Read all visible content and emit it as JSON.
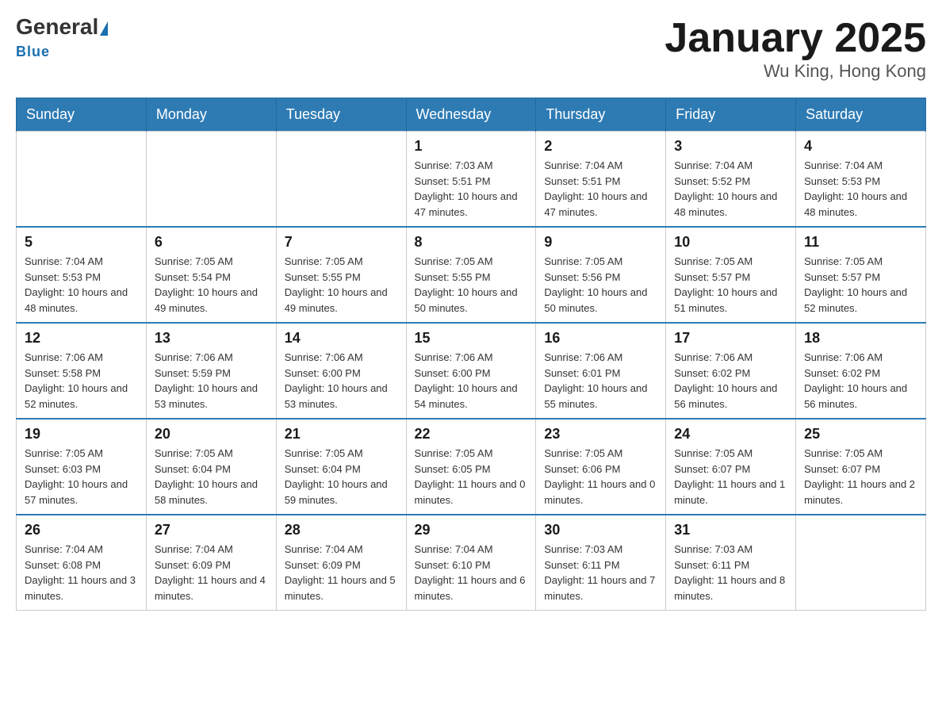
{
  "header": {
    "logo_general": "General",
    "logo_blue": "Blue",
    "title": "January 2025",
    "subtitle": "Wu King, Hong Kong"
  },
  "days_of_week": [
    "Sunday",
    "Monday",
    "Tuesday",
    "Wednesday",
    "Thursday",
    "Friday",
    "Saturday"
  ],
  "weeks": [
    [
      {
        "day": "",
        "info": ""
      },
      {
        "day": "",
        "info": ""
      },
      {
        "day": "",
        "info": ""
      },
      {
        "day": "1",
        "info": "Sunrise: 7:03 AM\nSunset: 5:51 PM\nDaylight: 10 hours\nand 47 minutes."
      },
      {
        "day": "2",
        "info": "Sunrise: 7:04 AM\nSunset: 5:51 PM\nDaylight: 10 hours\nand 47 minutes."
      },
      {
        "day": "3",
        "info": "Sunrise: 7:04 AM\nSunset: 5:52 PM\nDaylight: 10 hours\nand 48 minutes."
      },
      {
        "day": "4",
        "info": "Sunrise: 7:04 AM\nSunset: 5:53 PM\nDaylight: 10 hours\nand 48 minutes."
      }
    ],
    [
      {
        "day": "5",
        "info": "Sunrise: 7:04 AM\nSunset: 5:53 PM\nDaylight: 10 hours\nand 48 minutes."
      },
      {
        "day": "6",
        "info": "Sunrise: 7:05 AM\nSunset: 5:54 PM\nDaylight: 10 hours\nand 49 minutes."
      },
      {
        "day": "7",
        "info": "Sunrise: 7:05 AM\nSunset: 5:55 PM\nDaylight: 10 hours\nand 49 minutes."
      },
      {
        "day": "8",
        "info": "Sunrise: 7:05 AM\nSunset: 5:55 PM\nDaylight: 10 hours\nand 50 minutes."
      },
      {
        "day": "9",
        "info": "Sunrise: 7:05 AM\nSunset: 5:56 PM\nDaylight: 10 hours\nand 50 minutes."
      },
      {
        "day": "10",
        "info": "Sunrise: 7:05 AM\nSunset: 5:57 PM\nDaylight: 10 hours\nand 51 minutes."
      },
      {
        "day": "11",
        "info": "Sunrise: 7:05 AM\nSunset: 5:57 PM\nDaylight: 10 hours\nand 52 minutes."
      }
    ],
    [
      {
        "day": "12",
        "info": "Sunrise: 7:06 AM\nSunset: 5:58 PM\nDaylight: 10 hours\nand 52 minutes."
      },
      {
        "day": "13",
        "info": "Sunrise: 7:06 AM\nSunset: 5:59 PM\nDaylight: 10 hours\nand 53 minutes."
      },
      {
        "day": "14",
        "info": "Sunrise: 7:06 AM\nSunset: 6:00 PM\nDaylight: 10 hours\nand 53 minutes."
      },
      {
        "day": "15",
        "info": "Sunrise: 7:06 AM\nSunset: 6:00 PM\nDaylight: 10 hours\nand 54 minutes."
      },
      {
        "day": "16",
        "info": "Sunrise: 7:06 AM\nSunset: 6:01 PM\nDaylight: 10 hours\nand 55 minutes."
      },
      {
        "day": "17",
        "info": "Sunrise: 7:06 AM\nSunset: 6:02 PM\nDaylight: 10 hours\nand 56 minutes."
      },
      {
        "day": "18",
        "info": "Sunrise: 7:06 AM\nSunset: 6:02 PM\nDaylight: 10 hours\nand 56 minutes."
      }
    ],
    [
      {
        "day": "19",
        "info": "Sunrise: 7:05 AM\nSunset: 6:03 PM\nDaylight: 10 hours\nand 57 minutes."
      },
      {
        "day": "20",
        "info": "Sunrise: 7:05 AM\nSunset: 6:04 PM\nDaylight: 10 hours\nand 58 minutes."
      },
      {
        "day": "21",
        "info": "Sunrise: 7:05 AM\nSunset: 6:04 PM\nDaylight: 10 hours\nand 59 minutes."
      },
      {
        "day": "22",
        "info": "Sunrise: 7:05 AM\nSunset: 6:05 PM\nDaylight: 11 hours\nand 0 minutes."
      },
      {
        "day": "23",
        "info": "Sunrise: 7:05 AM\nSunset: 6:06 PM\nDaylight: 11 hours\nand 0 minutes."
      },
      {
        "day": "24",
        "info": "Sunrise: 7:05 AM\nSunset: 6:07 PM\nDaylight: 11 hours\nand 1 minute."
      },
      {
        "day": "25",
        "info": "Sunrise: 7:05 AM\nSunset: 6:07 PM\nDaylight: 11 hours\nand 2 minutes."
      }
    ],
    [
      {
        "day": "26",
        "info": "Sunrise: 7:04 AM\nSunset: 6:08 PM\nDaylight: 11 hours\nand 3 minutes."
      },
      {
        "day": "27",
        "info": "Sunrise: 7:04 AM\nSunset: 6:09 PM\nDaylight: 11 hours\nand 4 minutes."
      },
      {
        "day": "28",
        "info": "Sunrise: 7:04 AM\nSunset: 6:09 PM\nDaylight: 11 hours\nand 5 minutes."
      },
      {
        "day": "29",
        "info": "Sunrise: 7:04 AM\nSunset: 6:10 PM\nDaylight: 11 hours\nand 6 minutes."
      },
      {
        "day": "30",
        "info": "Sunrise: 7:03 AM\nSunset: 6:11 PM\nDaylight: 11 hours\nand 7 minutes."
      },
      {
        "day": "31",
        "info": "Sunrise: 7:03 AM\nSunset: 6:11 PM\nDaylight: 11 hours\nand 8 minutes."
      },
      {
        "day": "",
        "info": ""
      }
    ]
  ]
}
